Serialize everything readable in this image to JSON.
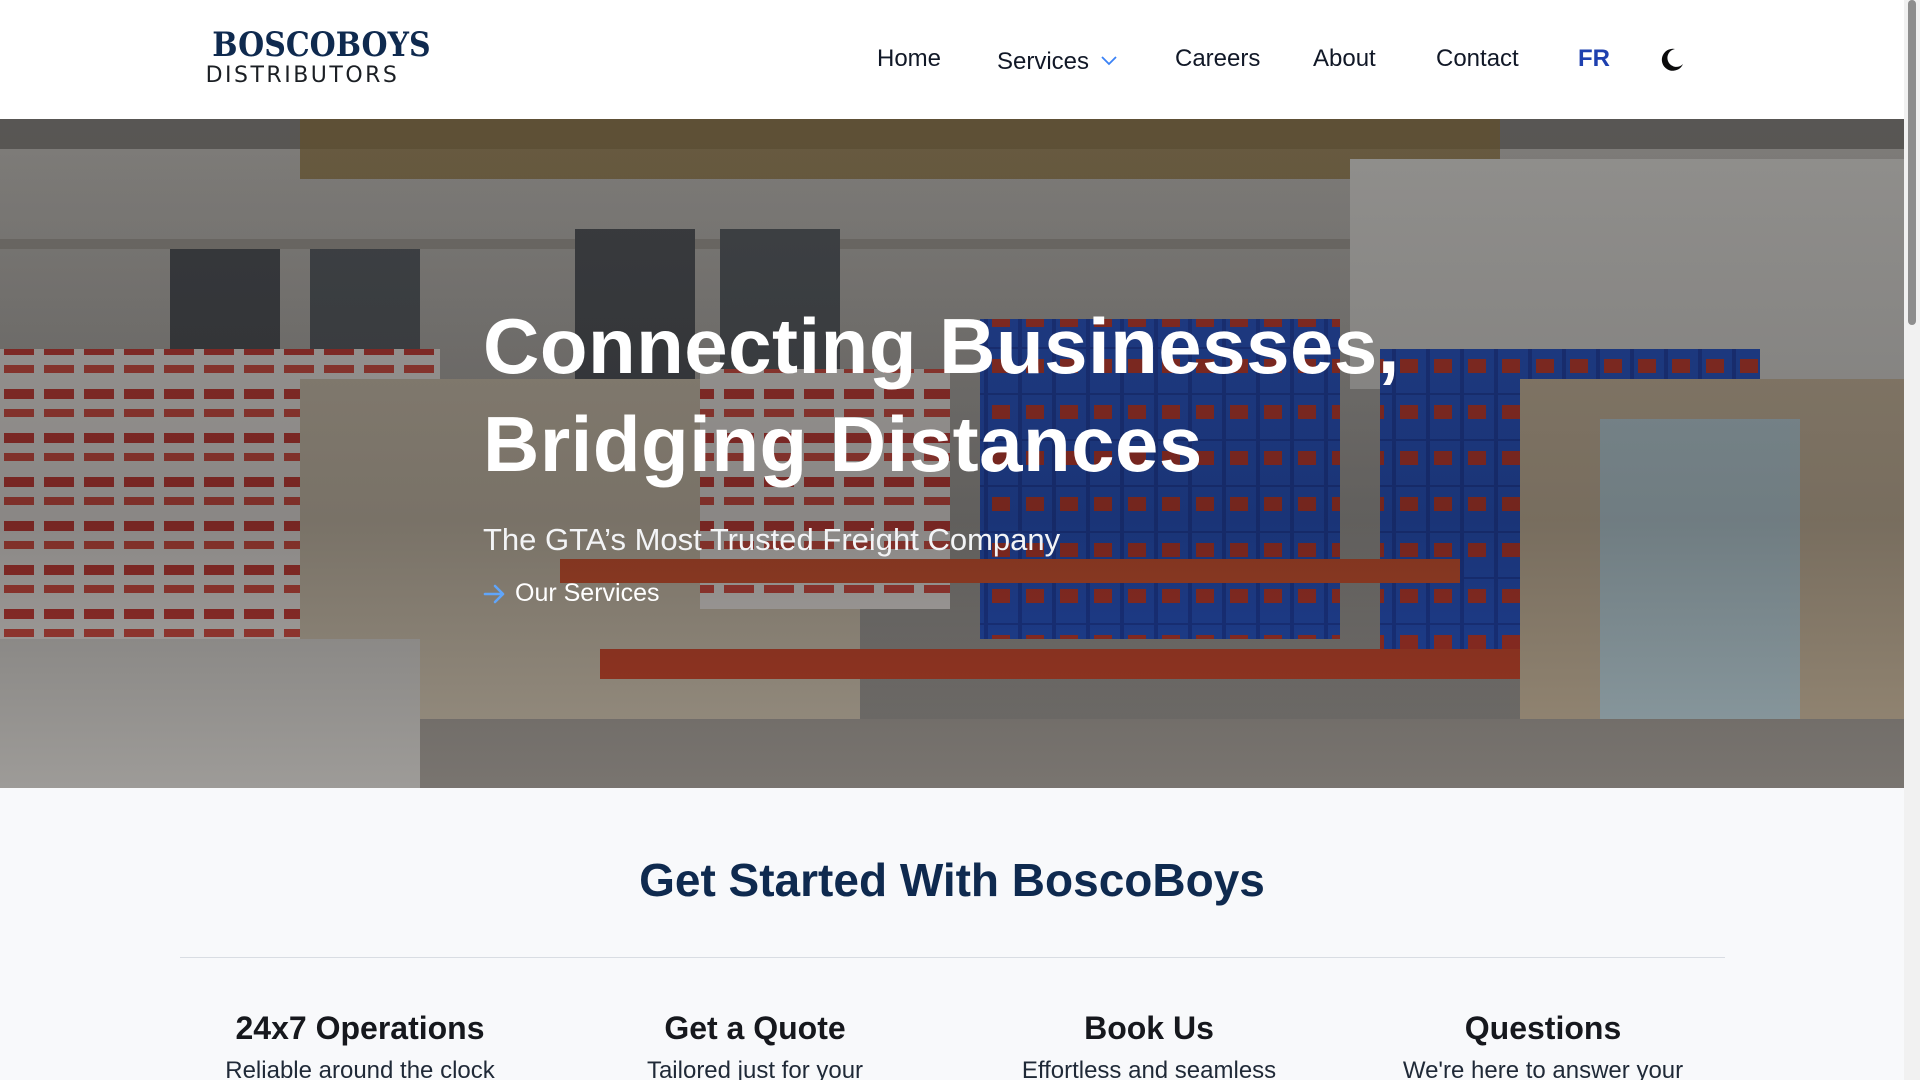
{
  "brand": {
    "name_top": "BOSCOBOYS",
    "name_bottom": "DISTRIBUTORS",
    "navy": "#0f2a4f"
  },
  "nav": {
    "home": "Home",
    "services": "Services",
    "careers": "Careers",
    "about": "About",
    "contact": "Contact",
    "language": "FR",
    "theme_icon": "moon-icon"
  },
  "hero": {
    "title_line1": "Connecting Businesses,",
    "title_line2": "Bridging Distances",
    "subtitle": "The GTA’s Most Trusted Freight Company",
    "cta": "Our Services",
    "cta_icon": "arrow-right-icon",
    "accent": "#60a5fa"
  },
  "get_started": {
    "title": "Get Started With BoscoBoys",
    "cards": [
      {
        "title": "24x7 Operations",
        "text": "Reliable around the clock"
      },
      {
        "title": "Get a Quote",
        "text": "Tailored just for your"
      },
      {
        "title": "Book Us",
        "text": "Effortless and seamless"
      },
      {
        "title": "Questions",
        "text": "We're here to answer your"
      }
    ]
  }
}
